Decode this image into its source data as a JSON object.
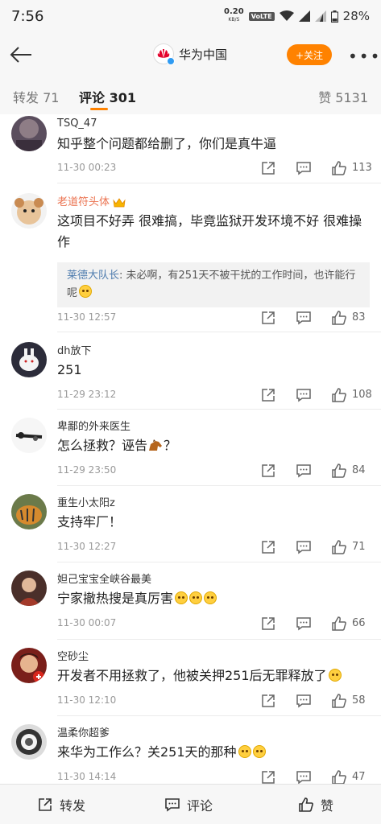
{
  "status_bar": {
    "time": "7:56",
    "net_speed": "0.20",
    "net_unit": "KB/S",
    "volte": "VoLTE",
    "battery": "28%"
  },
  "header": {
    "account_name": "华为中国",
    "follow_label": "+关注",
    "more_label": "•••"
  },
  "tabs": {
    "repost": "转发 71",
    "comment": "评论 301",
    "like": "赞 5131"
  },
  "comments": [
    {
      "user": "TSQ_47",
      "text": "知乎整个问题都给删了，你们是真牛逼",
      "time": "11-30 00:23",
      "likes": "113"
    },
    {
      "user": "老道符头体",
      "text": "这项目不好弄 很难搞，毕竟监狱开发环境不好 很难操作",
      "reply_user": "莱德大队长",
      "reply_text": ": 未必啊，有251天不被干扰的工作时间，也许能行呢",
      "time": "11-30 12:57",
      "likes": "83"
    },
    {
      "user": "dh放下",
      "text": "251",
      "time": "11-29 23:12",
      "likes": "108"
    },
    {
      "user": "卑鄙的外来医生",
      "text_a": "怎么拯救？诬告",
      "text_b": "？",
      "time": "11-29 23:50",
      "likes": "84"
    },
    {
      "user": "重生小太阳z",
      "text": "支持牢厂！",
      "time": "11-30 12:27",
      "likes": "71"
    },
    {
      "user": "妲己宝宝全峡谷最美",
      "text": "宁家撤热搜是真厉害",
      "time": "11-30 00:07",
      "likes": "66"
    },
    {
      "user": "空砂尘",
      "text": "开发者不用拯救了，他被关押251后无罪释放了",
      "time": "11-30 12:10",
      "likes": "58"
    },
    {
      "user": "温柔你超爹",
      "text": "来华为工作么？关251天的那种",
      "time": "11-30 14:14",
      "likes": "47"
    }
  ],
  "bottom_bar": {
    "repost": "转发",
    "comment": "评论",
    "like": "赞"
  },
  "colors": {
    "accent": "#ff8200",
    "vip_name": "#eb7350",
    "reply_user": "#507daf"
  }
}
